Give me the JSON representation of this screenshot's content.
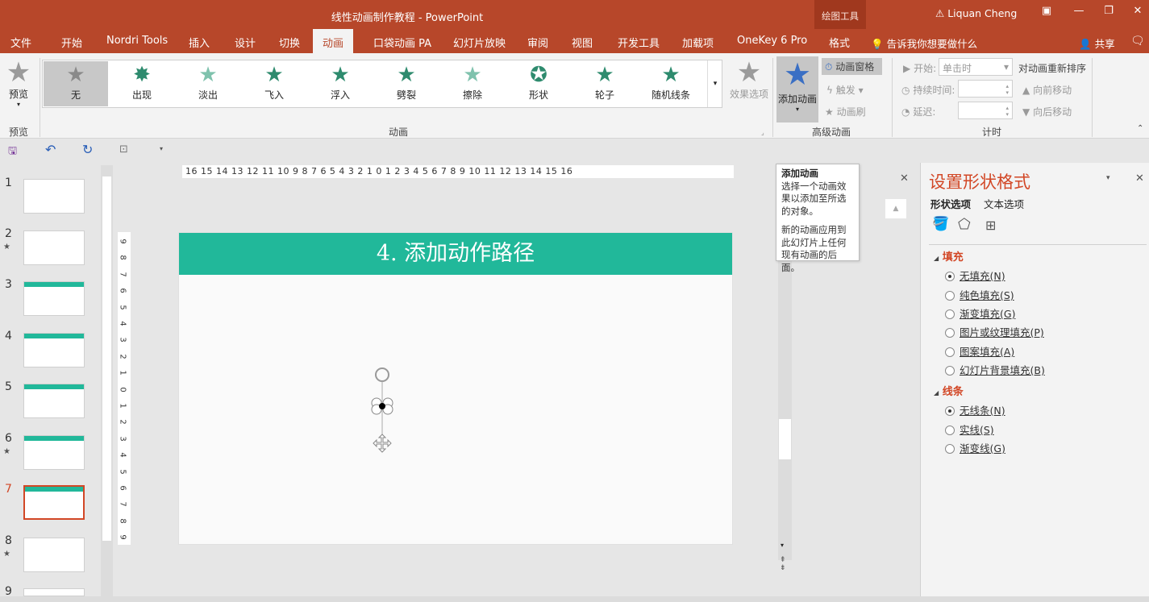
{
  "window": {
    "title": "线性动画制作教程 - PowerPoint",
    "context_group": "绘图工具",
    "user": "Liquan Cheng"
  },
  "tabs": [
    "文件",
    "开始",
    "Nordri Tools",
    "插入",
    "设计",
    "切换",
    "动画",
    "口袋动画 PA",
    "幻灯片放映",
    "审阅",
    "视图",
    "开发工具",
    "加载项",
    "OneKey 6 Pro",
    "格式"
  ],
  "active_tab": "动画",
  "tell_me": "告诉我你想要做什么",
  "share": "共享",
  "ribbon": {
    "preview": {
      "label": "预览",
      "group": "预览"
    },
    "animations": [
      "无",
      "出现",
      "淡出",
      "飞入",
      "浮入",
      "劈裂",
      "擦除",
      "形状",
      "轮子",
      "随机线条"
    ],
    "animation_group": "动画",
    "effect_options": "效果选项",
    "add_animation": "添加动画",
    "animation_pane": "动画窗格",
    "trigger": "触发",
    "painter": "动画刷",
    "advanced_group": "高级动画",
    "start_label": "开始:",
    "start_value": "单击时",
    "duration_label": "持续时间:",
    "delay_label": "延迟:",
    "reorder": "对动画重新排序",
    "move_earlier": "向前移动",
    "move_later": "向后移动",
    "timing_group": "计时"
  },
  "slides": [
    {
      "n": "1"
    },
    {
      "n": "2"
    },
    {
      "n": "3"
    },
    {
      "n": "4"
    },
    {
      "n": "5"
    },
    {
      "n": "6"
    },
    {
      "n": "7"
    },
    {
      "n": "8"
    },
    {
      "n": "9"
    }
  ],
  "current_slide": "7",
  "ruler_h": "16 15 14 13 12 11 10 9 8 7 6 5 4 3 2 1 0 1 2 3 4 5 6 7 8 9 10 11 12 13 14 15 16",
  "ruler_v": [
    "9",
    "8",
    "7",
    "6",
    "5",
    "4",
    "3",
    "2",
    "1",
    "0",
    "1",
    "2",
    "3",
    "4",
    "5",
    "6",
    "7",
    "8",
    "9"
  ],
  "slide": {
    "title": "4. 添加动作路径"
  },
  "tooltip": {
    "title": "添加动画",
    "line1": "选择一个动画效果以添加至所选的对象。",
    "line2": "新的动画应用到此幻灯片上任何现有动画的后面。"
  },
  "pane": {
    "title": "设置形状格式",
    "tab_shape": "形状选项",
    "tab_text": "文本选项",
    "fill_section": "填充",
    "fill_options": [
      "无填充(N)",
      "纯色填充(S)",
      "渐变填充(G)",
      "图片或纹理填充(P)",
      "图案填充(A)",
      "幻灯片背景填充(B)"
    ],
    "line_section": "线条",
    "line_options": [
      "无线条(N)",
      "实线(S)",
      "渐变线(G)"
    ]
  }
}
